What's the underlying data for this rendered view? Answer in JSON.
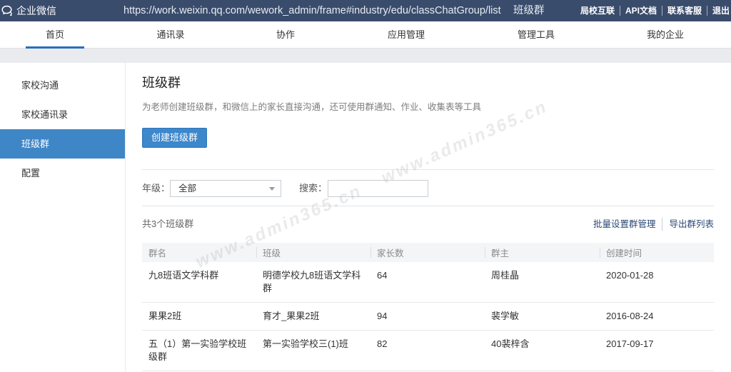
{
  "topbar": {
    "logo_text": "企业微信",
    "logo_icon": "chat-bubbles-icon",
    "url_text": "https://work.weixin.qq.com/wework_admin/frame#industry/edu/classChatGroup/list",
    "page_name": "班级群",
    "links": [
      "局校互联",
      "API文档",
      "联系客服",
      "退出"
    ]
  },
  "nav": {
    "items": [
      {
        "label": "首页",
        "active": true
      },
      {
        "label": "通讯录",
        "active": false
      },
      {
        "label": "协作",
        "active": false
      },
      {
        "label": "应用管理",
        "active": false
      },
      {
        "label": "管理工具",
        "active": false
      },
      {
        "label": "我的企业",
        "active": false
      }
    ]
  },
  "sidebar": {
    "items": [
      {
        "label": "家校沟通",
        "active": false
      },
      {
        "label": "家校通讯录",
        "active": false
      },
      {
        "label": "班级群",
        "active": true
      },
      {
        "label": "配置",
        "active": false
      }
    ]
  },
  "main": {
    "title": "班级群",
    "description": "为老师创建班级群，和微信上的家长直接沟通，还可使用群通知、作业、收集表等工具",
    "create_button": "创建班级群",
    "filter": {
      "grade_label": "年级：",
      "grade_selected": "全部",
      "grade_icon": "chevron-down-icon",
      "search_label": "搜索："
    },
    "count_text": "共3个班级群",
    "actions": {
      "batch_manage": "批量设置群管理",
      "export": "导出群列表"
    },
    "table": {
      "headers": [
        "群名",
        "班级",
        "家长数",
        "群主",
        "创建时间"
      ],
      "rows": [
        [
          "九8班语文学科群",
          "明德学校九8班语文学科群",
          "64",
          "周桂晶",
          "2020-01-28"
        ],
        [
          "果果2班",
          "育才_果果2班",
          "94",
          "裴学敏",
          "2016-08-24"
        ],
        [
          "五（1）第一实验学校班级群",
          "第一实验学校三(1)班",
          "82",
          "40裴梓含",
          "2017-09-17"
        ]
      ]
    }
  },
  "watermark": "www.admin365.cn",
  "colors": {
    "topbar": "#3a4c6c",
    "accent": "#3f86c7",
    "link": "#2c4a75",
    "nav_active": "#2a6ebb"
  }
}
